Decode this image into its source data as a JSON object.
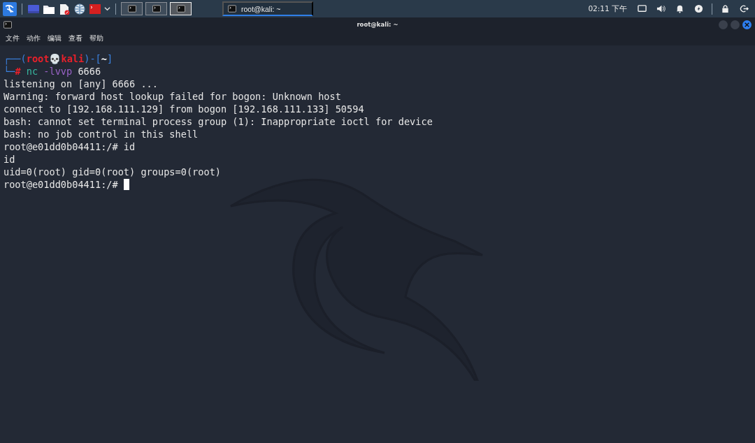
{
  "taskbar": {
    "launchers": [
      {
        "kind": "desktop"
      },
      {
        "kind": "folder"
      },
      {
        "kind": "document"
      },
      {
        "kind": "globe"
      },
      {
        "kind": "terminal"
      }
    ],
    "workspaces": [
      {
        "selected": false
      },
      {
        "selected": false
      },
      {
        "selected": true
      }
    ],
    "tasks": [
      {
        "label": "root@kali: ~",
        "selected": true
      }
    ],
    "clock": "02:11 下午"
  },
  "window": {
    "title": "root@kali: ~"
  },
  "menu": [
    "文件",
    "动作",
    "编辑",
    "查看",
    "帮助"
  ],
  "terminal": {
    "lines": [
      [
        {
          "text": "┌──(",
          "kind": "frame"
        },
        {
          "text": "root💀kali",
          "kind": "user"
        },
        {
          "text": ")-[",
          "kind": "frame"
        },
        {
          "text": "~",
          "kind": "path"
        },
        {
          "text": "]",
          "kind": "frame"
        }
      ],
      [
        {
          "text": "└─",
          "kind": "frame"
        },
        {
          "text": "# ",
          "kind": "hash"
        },
        {
          "text": "nc ",
          "kind": "cmd"
        },
        {
          "text": "-lvvp ",
          "kind": "flag"
        },
        {
          "text": "6666",
          "kind": "plain"
        }
      ],
      [
        {
          "text": "listening on [any] 6666 ...",
          "kind": "plain"
        }
      ],
      [
        {
          "text": "Warning: forward host lookup failed for bogon: Unknown host",
          "kind": "plain"
        }
      ],
      [
        {
          "text": "connect to [192.168.111.129] from bogon [192.168.111.133] 50594",
          "kind": "plain"
        }
      ],
      [
        {
          "text": "bash: cannot set terminal process group (1): Inappropriate ioctl for device",
          "kind": "plain"
        }
      ],
      [
        {
          "text": "bash: no job control in this shell",
          "kind": "plain"
        }
      ],
      [
        {
          "text": "root@e01dd0b04411:/# id",
          "kind": "plain"
        }
      ],
      [
        {
          "text": "id",
          "kind": "plain"
        }
      ],
      [
        {
          "text": "uid=0(root) gid=0(root) groups=0(root)",
          "kind": "plain"
        }
      ],
      [
        {
          "text": "root@e01dd0b04411:/# ",
          "kind": "plain"
        }
      ]
    ],
    "cursor": true
  }
}
